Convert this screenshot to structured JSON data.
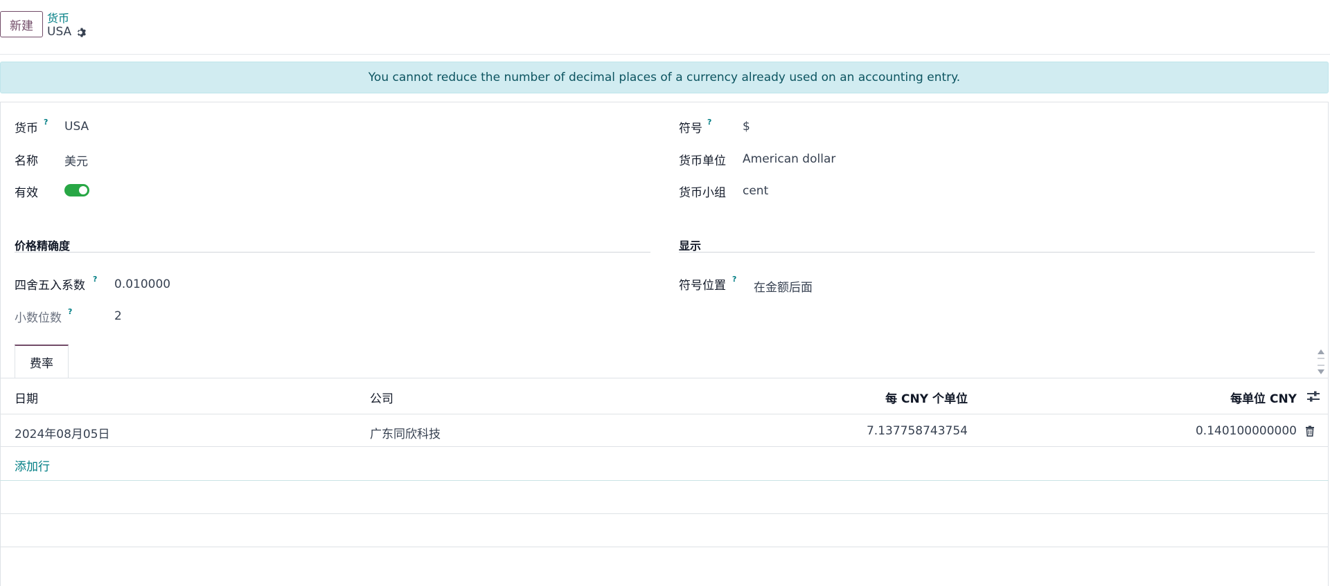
{
  "control_panel": {
    "new_button": "新建",
    "breadcrumb": "货币",
    "record_name": "USA"
  },
  "alert": {
    "message": "You cannot reduce the number of decimal places of a currency already used on an accounting entry."
  },
  "form": {
    "left": {
      "currency_label": "货币",
      "currency_value": "USA",
      "name_label": "名称",
      "name_value": "美元",
      "active_label": "有效",
      "active_value": true
    },
    "right": {
      "symbol_label": "符号",
      "symbol_value": "$",
      "unit_label": "货币单位",
      "unit_value": "American dollar",
      "subunit_label": "货币小组",
      "subunit_value": "cent"
    },
    "price_precision": {
      "title": "价格精确度",
      "rounding_label": "四舍五入系数",
      "rounding_value": "0.010000",
      "decimals_label": "小数位数",
      "decimals_value": "2"
    },
    "display": {
      "title": "显示",
      "position_label": "符号位置",
      "position_value": "在金额后面"
    },
    "tooltip_mark": "?"
  },
  "tabs": [
    {
      "label": "费率"
    }
  ],
  "rates_table": {
    "columns": [
      "日期",
      "公司",
      "每 CNY 个单位",
      "每单位 CNY"
    ],
    "rows": [
      {
        "date": "2024年08月05日",
        "company": "广东同欣科技",
        "units_per_cny": "7.137758743754",
        "cny_per_unit": "0.140100000000"
      }
    ],
    "add_line": "添加行"
  },
  "colors": {
    "brand": "#714B67",
    "link": "#017e84",
    "toggle_on": "#28a745",
    "alert_bg": "#d1ecf1"
  }
}
